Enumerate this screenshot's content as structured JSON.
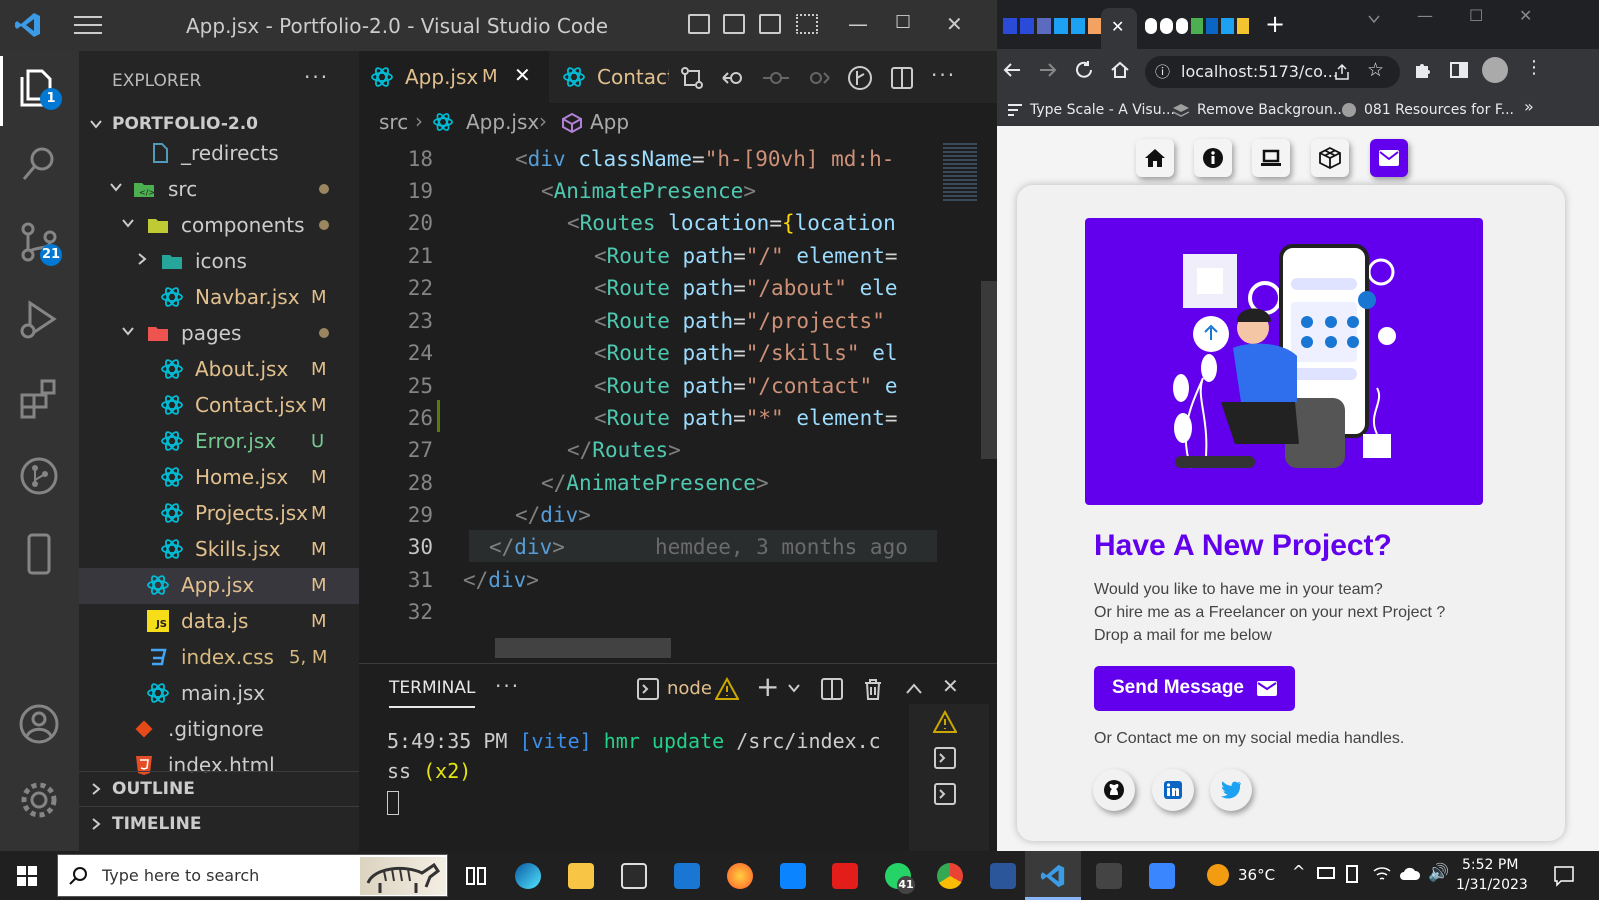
{
  "vscode": {
    "window_title": "App.jsx - Portfolio-2.0 - Visual Studio Code",
    "activity": {
      "explorer_badge": "1",
      "scm_badge": "21"
    },
    "explorer": {
      "header": "EXPLORER",
      "project": "PORTFOLIO-2.0",
      "items": [
        {
          "name": "_redirects",
          "status": ""
        },
        {
          "name": "src",
          "status": ""
        },
        {
          "name": "components",
          "status": ""
        },
        {
          "name": "icons",
          "status": ""
        },
        {
          "name": "Navbar.jsx",
          "status": "M"
        },
        {
          "name": "pages",
          "status": ""
        },
        {
          "name": "About.jsx",
          "status": "M"
        },
        {
          "name": "Contact.jsx",
          "status": "M"
        },
        {
          "name": "Error.jsx",
          "status": "U"
        },
        {
          "name": "Home.jsx",
          "status": "M"
        },
        {
          "name": "Projects.jsx",
          "status": "M"
        },
        {
          "name": "Skills.jsx",
          "status": "M"
        },
        {
          "name": "App.jsx",
          "status": "M"
        },
        {
          "name": "data.js",
          "status": "M"
        },
        {
          "name": "index.css",
          "status": "5, M"
        },
        {
          "name": "main.jsx",
          "status": ""
        },
        {
          "name": ".gitignore",
          "status": ""
        },
        {
          "name": "index.html",
          "status": ""
        }
      ],
      "outline": "OUTLINE",
      "timeline": "TIMELINE"
    },
    "tabs": [
      {
        "label": "App.jsx",
        "status": "M"
      },
      {
        "label": "Contact"
      }
    ],
    "breadcrumb": {
      "folder": "src",
      "file": "App.jsx",
      "symbol": "App"
    },
    "code": {
      "line_numbers": [
        "18",
        "19",
        "20",
        "21",
        "22",
        "23",
        "24",
        "25",
        "26",
        "27",
        "28",
        "29",
        "30",
        "31",
        "32"
      ],
      "blame": "hemdee, 3 months ago"
    },
    "terminal": {
      "tab": "TERMINAL",
      "shell": "node",
      "line1_time": "5:49:35 PM",
      "line1_tag": "[vite]",
      "line1_msg": "hmr update",
      "line1_path": "/src/index.c",
      "line2": "ss",
      "line2_count": "(x2)"
    }
  },
  "chrome": {
    "url": "localhost:5173/co...",
    "bookmarks": [
      "Type Scale - A Visu...",
      "Remove Backgroun...",
      "081 Resources for F..."
    ],
    "page": {
      "title": "Have A New Project?",
      "lines": [
        "Would you like to have me in your team?",
        "Or hire me as a Freelancer on your next Project ?",
        "Drop a mail for me below"
      ],
      "send_label": "Send Message",
      "social_text": "Or Contact me on my social media handles."
    }
  },
  "taskbar": {
    "search_placeholder": "Type here to search",
    "whatsapp_badge": "41",
    "temperature": "36°C",
    "time": "5:52 PM",
    "date": "1/31/2023"
  }
}
